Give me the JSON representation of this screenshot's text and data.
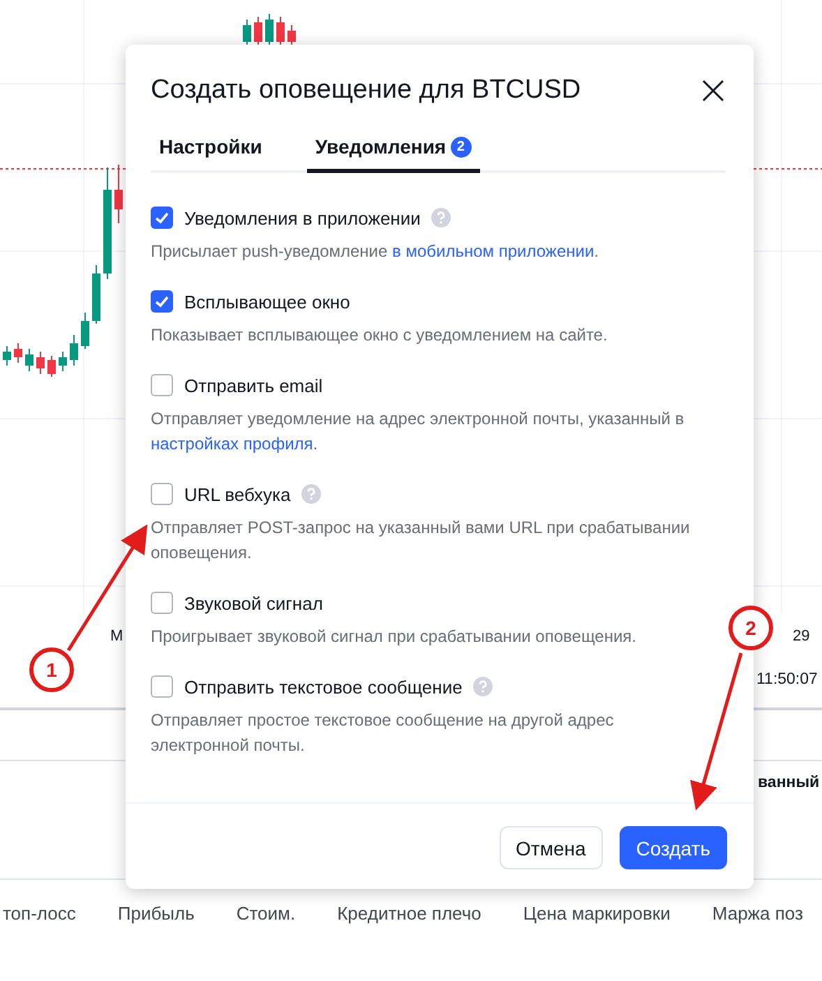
{
  "chart": {
    "axis_labels": [
      {
        "text": "М"
      },
      {
        "text": "29"
      }
    ],
    "time_label": "11:50:07"
  },
  "table": {
    "header_fragment": "ванный",
    "columns": [
      "топ-лосс",
      "Прибыль",
      "Стоим.",
      "Кредитное плечо",
      "Цена маркировки",
      "Маржа поз"
    ]
  },
  "dialog": {
    "title": "Создать оповещение для BTCUSD",
    "tabs": [
      {
        "label": "Настройки",
        "selected": false
      },
      {
        "label": "Уведомления",
        "selected": true,
        "badge": "2"
      }
    ],
    "options": [
      {
        "label": "Уведомления в приложении",
        "checked": true,
        "help": true,
        "description": [
          {
            "kind": "text",
            "text": "Присылает push-уведомление "
          },
          {
            "kind": "link",
            "text": "в мобильном приложении"
          },
          {
            "kind": "text",
            "text": "."
          }
        ]
      },
      {
        "label": "Всплывающее окно",
        "checked": true,
        "help": false,
        "description": [
          {
            "kind": "text",
            "text": "Показывает всплывающее окно с уведомлением на сайте."
          }
        ]
      },
      {
        "label": "Отправить email",
        "checked": false,
        "help": false,
        "description": [
          {
            "kind": "text",
            "text": "Отправляет уведомление на адрес электронной почты, указанный в "
          },
          {
            "kind": "link",
            "text": "настройках профиля"
          },
          {
            "kind": "text",
            "text": "."
          }
        ]
      },
      {
        "label": "URL вебхука",
        "checked": false,
        "help": true,
        "description": [
          {
            "kind": "text",
            "text": "Отправляет POST-запрос на указанный вами URL при срабатывании оповещения."
          }
        ]
      },
      {
        "label": "Звуковой сигнал",
        "checked": false,
        "help": false,
        "description": [
          {
            "kind": "text",
            "text": "Проигрывает звуковой сигнал при срабатывании оповещения."
          }
        ]
      },
      {
        "label": "Отправить текстовое сообщение",
        "checked": false,
        "help": true,
        "description": [
          {
            "kind": "text",
            "text": "Отправляет простое текстовое сообщение на другой адрес электронной почты."
          }
        ]
      }
    ],
    "buttons": [
      {
        "label": "Отмена",
        "kind": "secondary"
      },
      {
        "label": "Создать",
        "kind": "primary"
      }
    ]
  },
  "annotations": [
    {
      "number": "1"
    },
    {
      "number": "2"
    }
  ]
}
